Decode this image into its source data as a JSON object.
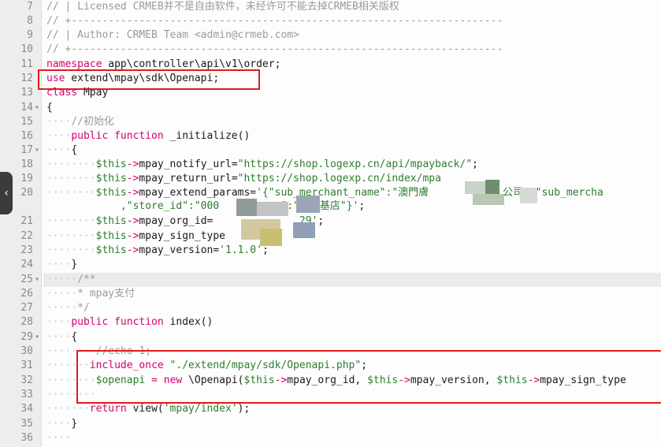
{
  "editor": {
    "collapse_icon": "chevron-left-icon",
    "lines": [
      {
        "n": "7",
        "fold": "",
        "segs": [
          {
            "c": "cm",
            "t": "// | Licensed CRMEB并不是自由软件，未经许可不能去掉CRMEB相关版权"
          }
        ]
      },
      {
        "n": "8",
        "fold": "",
        "segs": [
          {
            "c": "cm",
            "t": "// +----------------------------------------------------------------------"
          }
        ]
      },
      {
        "n": "9",
        "fold": "",
        "segs": [
          {
            "c": "cm",
            "t": "// | Author: CRMEB Team <admin@crmeb.com>"
          }
        ]
      },
      {
        "n": "10",
        "fold": "",
        "segs": [
          {
            "c": "cm",
            "t": "// +----------------------------------------------------------------------"
          }
        ]
      },
      {
        "n": "11",
        "fold": "",
        "segs": [
          {
            "c": "kw",
            "t": "namespace"
          },
          {
            "c": "",
            "t": " app\\controller\\api\\v1\\order;"
          }
        ]
      },
      {
        "n": "12",
        "fold": "",
        "segs": [
          {
            "c": "kw",
            "t": "use"
          },
          {
            "c": "",
            "t": " extend\\mpay\\sdk\\Openapi;"
          }
        ]
      },
      {
        "n": "13",
        "fold": "",
        "segs": [
          {
            "c": "kw",
            "t": "class"
          },
          {
            "c": "",
            "t": " Mpay"
          }
        ]
      },
      {
        "n": "14",
        "fold": "▾",
        "segs": [
          {
            "c": "",
            "t": "{"
          }
        ]
      },
      {
        "n": "15",
        "fold": "",
        "segs": [
          {
            "c": "ws",
            "t": "    "
          },
          {
            "c": "cm",
            "t": "//初始化"
          }
        ]
      },
      {
        "n": "16",
        "fold": "",
        "segs": [
          {
            "c": "ws",
            "t": "    "
          },
          {
            "c": "kw",
            "t": "public function"
          },
          {
            "c": "",
            "t": " _initialize()"
          }
        ]
      },
      {
        "n": "17",
        "fold": "▾",
        "segs": [
          {
            "c": "ws",
            "t": "    "
          },
          {
            "c": "",
            "t": "{"
          }
        ]
      },
      {
        "n": "18",
        "fold": "",
        "segs": [
          {
            "c": "ws",
            "t": "        "
          },
          {
            "c": "var",
            "t": "$this"
          },
          {
            "c": "kw",
            "t": "->"
          },
          {
            "c": "",
            "t": "mpay_notify_url="
          },
          {
            "c": "str",
            "t": "\"https://shop.logexp.cn/api/mpayback/\""
          },
          {
            "c": "",
            "t": ";"
          }
        ]
      },
      {
        "n": "19",
        "fold": "",
        "segs": [
          {
            "c": "ws",
            "t": "        "
          },
          {
            "c": "var",
            "t": "$this"
          },
          {
            "c": "kw",
            "t": "->"
          },
          {
            "c": "",
            "t": "mpay_return_url="
          },
          {
            "c": "str",
            "t": "\"https://shop.logexp.cn/index/mpa"
          }
        ]
      },
      {
        "n": "20",
        "fold": "",
        "segs": [
          {
            "c": "ws",
            "t": "        "
          },
          {
            "c": "var",
            "t": "$this"
          },
          {
            "c": "kw",
            "t": "->"
          },
          {
            "c": "",
            "t": "mpay_extend_params="
          },
          {
            "c": "str",
            "t": "'{\"sub_merchant_name\":\"澳門膚"
          },
          {
            "c": "",
            "t": "            "
          },
          {
            "c": "str",
            "t": "公司\",\"sub_mercha"
          }
        ]
      },
      {
        "n": "",
        "fold": "",
        "segs": [
          {
            "c": "",
            "t": "            "
          },
          {
            "c": "str",
            "t": ",\"store_id\":\"000"
          },
          {
            "c": "",
            "t": "         "
          },
          {
            "c": "str",
            "t": "e\":\"筷子基店\"}'"
          },
          {
            "c": "",
            "t": ";"
          }
        ]
      },
      {
        "n": "21",
        "fold": "",
        "segs": [
          {
            "c": "ws",
            "t": "        "
          },
          {
            "c": "var",
            "t": "$this"
          },
          {
            "c": "kw",
            "t": "->"
          },
          {
            "c": "",
            "t": "mpay_org_id="
          },
          {
            "c": "",
            "t": "              "
          },
          {
            "c": "str",
            "t": "29'"
          },
          {
            "c": "",
            "t": ";"
          }
        ]
      },
      {
        "n": "22",
        "fold": "",
        "segs": [
          {
            "c": "ws",
            "t": "        "
          },
          {
            "c": "var",
            "t": "$this"
          },
          {
            "c": "kw",
            "t": "->"
          },
          {
            "c": "",
            "t": "mpay_sign_type"
          }
        ]
      },
      {
        "n": "23",
        "fold": "",
        "segs": [
          {
            "c": "ws",
            "t": "        "
          },
          {
            "c": "var",
            "t": "$this"
          },
          {
            "c": "kw",
            "t": "->"
          },
          {
            "c": "",
            "t": "mpay_version="
          },
          {
            "c": "str",
            "t": "'1.1.0'"
          },
          {
            "c": "",
            "t": ";"
          }
        ]
      },
      {
        "n": "24",
        "fold": "",
        "segs": [
          {
            "c": "ws",
            "t": "    "
          },
          {
            "c": "",
            "t": "}"
          }
        ]
      },
      {
        "n": "25",
        "fold": "▾",
        "segs": [
          {
            "c": "ws",
            "t": "     "
          },
          {
            "c": "cm",
            "t": "/**"
          }
        ]
      },
      {
        "n": "26",
        "fold": "",
        "segs": [
          {
            "c": "ws",
            "t": "     "
          },
          {
            "c": "cm",
            "t": "* mpay支付"
          }
        ]
      },
      {
        "n": "27",
        "fold": "",
        "segs": [
          {
            "c": "ws",
            "t": "     "
          },
          {
            "c": "cm",
            "t": "*/"
          }
        ]
      },
      {
        "n": "28",
        "fold": "",
        "segs": [
          {
            "c": "ws",
            "t": "    "
          },
          {
            "c": "kw",
            "t": "public function"
          },
          {
            "c": "",
            "t": " index()"
          }
        ]
      },
      {
        "n": "29",
        "fold": "▾",
        "segs": [
          {
            "c": "ws",
            "t": "    "
          },
          {
            "c": "",
            "t": "{"
          }
        ]
      },
      {
        "n": "30",
        "fold": "",
        "segs": [
          {
            "c": "ws",
            "t": "        "
          },
          {
            "c": "cm",
            "t": "//echo 1;"
          }
        ]
      },
      {
        "n": "31",
        "fold": "",
        "segs": [
          {
            "c": "ws",
            "t": "       "
          },
          {
            "c": "kw",
            "t": "include_once"
          },
          {
            "c": "",
            "t": " "
          },
          {
            "c": "str",
            "t": "\"./extend/mpay/sdk/Openapi.php\""
          },
          {
            "c": "",
            "t": ";"
          }
        ]
      },
      {
        "n": "32",
        "fold": "",
        "segs": [
          {
            "c": "ws",
            "t": "        "
          },
          {
            "c": "var",
            "t": "$openapi"
          },
          {
            "c": "",
            "t": " "
          },
          {
            "c": "kw",
            "t": "="
          },
          {
            "c": "",
            "t": " "
          },
          {
            "c": "kw",
            "t": "new"
          },
          {
            "c": "",
            "t": " \\Openapi("
          },
          {
            "c": "var",
            "t": "$this"
          },
          {
            "c": "kw",
            "t": "->"
          },
          {
            "c": "",
            "t": "mpay_org_id, "
          },
          {
            "c": "var",
            "t": "$this"
          },
          {
            "c": "kw",
            "t": "->"
          },
          {
            "c": "",
            "t": "mpay_version, "
          },
          {
            "c": "var",
            "t": "$this"
          },
          {
            "c": "kw",
            "t": "->"
          },
          {
            "c": "",
            "t": "mpay_sign_type"
          }
        ]
      },
      {
        "n": "33",
        "fold": "",
        "segs": [
          {
            "c": "ws",
            "t": "        "
          }
        ]
      },
      {
        "n": "34",
        "fold": "",
        "segs": [
          {
            "c": "ws",
            "t": "       "
          },
          {
            "c": "kw",
            "t": "return"
          },
          {
            "c": "",
            "t": " view("
          },
          {
            "c": "str",
            "t": "'mpay/index'"
          },
          {
            "c": "",
            "t": ");"
          }
        ]
      },
      {
        "n": "35",
        "fold": "",
        "segs": [
          {
            "c": "ws",
            "t": "    "
          },
          {
            "c": "",
            "t": "}"
          }
        ]
      },
      {
        "n": "36",
        "fold": "",
        "segs": [
          {
            "c": "ws",
            "t": "    "
          }
        ]
      }
    ]
  },
  "colors": {
    "red_box": "#e01b1b",
    "keyword": "#d6006f",
    "string": "#2e7d2e",
    "comment": "#9a9a9a"
  }
}
